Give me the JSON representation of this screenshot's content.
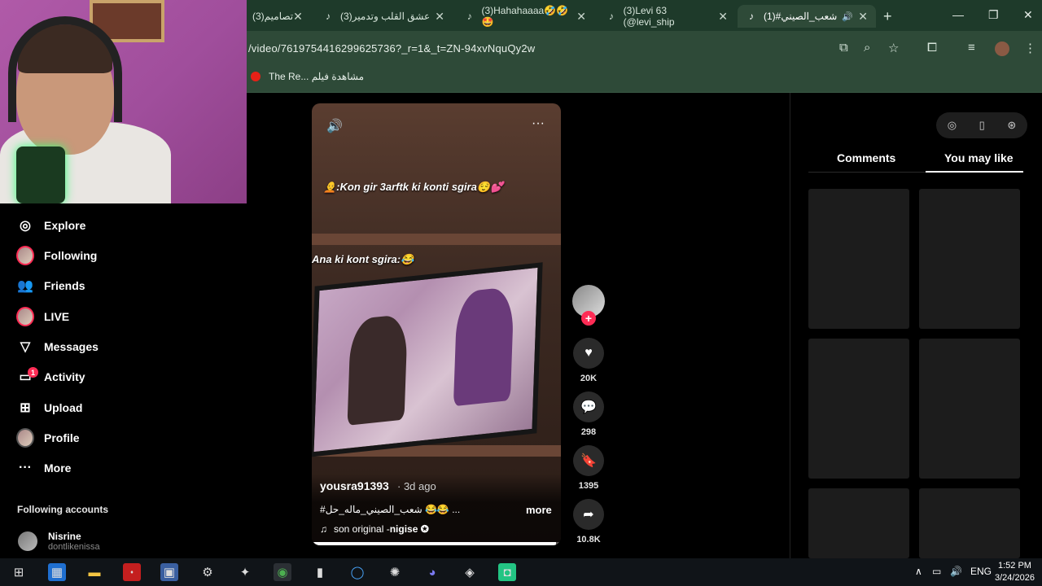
{
  "browser": {
    "tabs": [
      {
        "label": "(3)تصاميم",
        "active": false
      },
      {
        "label": "(3)عشق القلب وتدمير",
        "active": false
      },
      {
        "label": "(3)Hahahaaaa🤣🤣🤩",
        "active": false
      },
      {
        "label": "(3)Levi 63 (@levi_ship",
        "active": false
      },
      {
        "label": "(1)#شعب_الصيني",
        "active": true
      }
    ],
    "url": "/video/7619754416299625736?_r=1&_t=ZN-94xvNquQy2w",
    "bookmarks": [
      "The Re... مشاهدة فيلم"
    ]
  },
  "sidebar": {
    "items": [
      {
        "label": "Explore",
        "icon": "compass-icon"
      },
      {
        "label": "Following",
        "icon": "avatar-icon"
      },
      {
        "label": "Friends",
        "icon": "friends-icon"
      },
      {
        "label": "LIVE",
        "icon": "live-icon"
      },
      {
        "label": "Messages",
        "icon": "messages-icon"
      },
      {
        "label": "Activity",
        "icon": "activity-icon",
        "badge": "1"
      },
      {
        "label": "Upload",
        "icon": "upload-icon"
      },
      {
        "label": "Profile",
        "icon": "profile-icon"
      },
      {
        "label": "More",
        "icon": "more-icon"
      }
    ],
    "following_title": "Following accounts",
    "accounts": [
      {
        "name": "Nisrine",
        "handle": "dontlikenissa"
      }
    ]
  },
  "video": {
    "captions": [
      "🧑‍🦲:Kon gir 3arftk ki konti sgira😌💕",
      "Ana ki kont sgira:😂"
    ],
    "author": "yousra91393",
    "ago": "· 3d ago",
    "description": "#شعب_الصيني_ماله_حل 😂😂 ...",
    "more_label": "more",
    "sound": "son original - ",
    "sound_author": "nigise ✪",
    "progress": 0.98
  },
  "actions": {
    "likes": "20K",
    "comments": "298",
    "saves": "1395",
    "shares": "10.8K"
  },
  "right_panel": {
    "tabs": [
      "Comments",
      "You may like"
    ],
    "active_tab": "You may like"
  },
  "taskbar": {
    "language": "ENG",
    "time": "1:52 PM",
    "date": "3/24/2026"
  },
  "colors": {
    "accent": "#fe2c55",
    "browser_frame": "#2e4a38",
    "card": "#1c1c1c"
  }
}
